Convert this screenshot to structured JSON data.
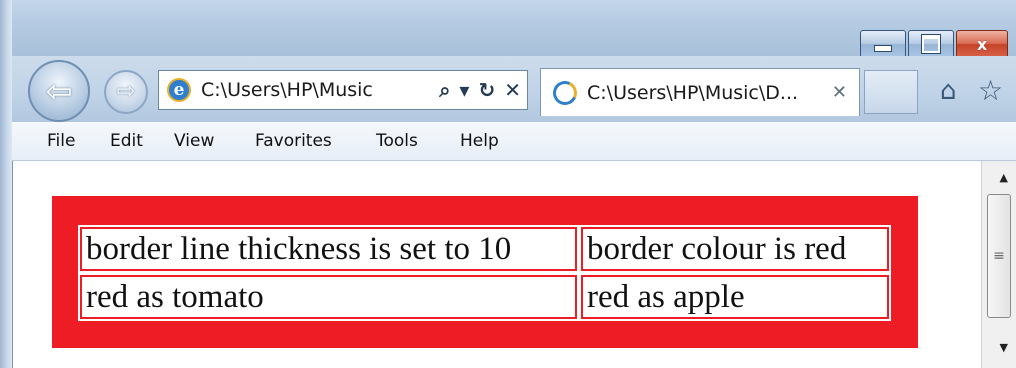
{
  "window": {
    "colors": {
      "accent": "#a9c0da",
      "table_border": "#ee1c25"
    }
  },
  "caption": {
    "minimize_icon": "minimize-icon",
    "maximize_icon": "maximize-icon",
    "close_glyph": "x"
  },
  "nav": {
    "back_arrow": "⇦",
    "forward_arrow": "⇨"
  },
  "address": {
    "favicon": "e",
    "url": "C:\\Users\\HP\\Music",
    "search_glyph": "⌕",
    "dropdown_glyph": "▾",
    "refresh_glyph": "↻",
    "stop_glyph": "✕"
  },
  "tab": {
    "title": "C:\\Users\\HP\\Music\\D...",
    "close_glyph": "✕"
  },
  "toolbar": {
    "home_glyph": "⌂",
    "favorites_glyph": "☆"
  },
  "menu": [
    "File",
    "Edit",
    "View",
    "Favorites",
    "Tools",
    "Help"
  ],
  "table": {
    "rows": [
      [
        "border line thickness is set to 10",
        "border colour is red"
      ],
      [
        "red as tomato",
        "red as apple"
      ]
    ]
  },
  "scrollbar": {
    "up_glyph": "▲",
    "down_glyph": "▼",
    "grip_glyph": "≡"
  }
}
